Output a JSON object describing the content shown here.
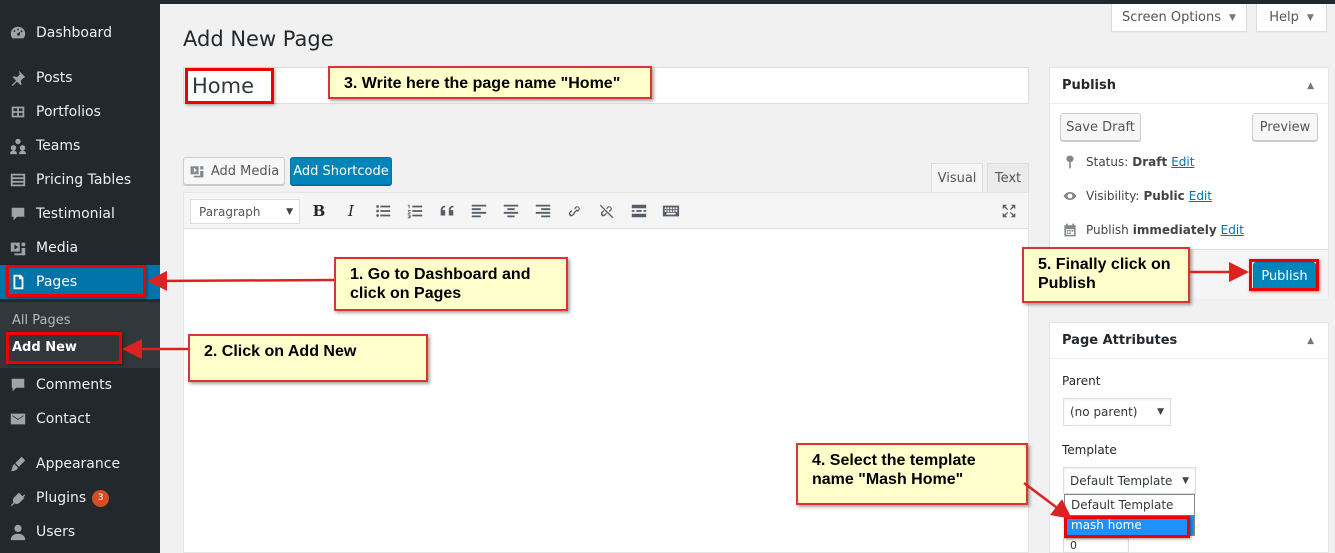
{
  "colors": {
    "sidebar_bg": "#23282d",
    "accent_blue": "#0073aa",
    "primary_button": "#0085ba",
    "annotation_fill": "#ffffcc",
    "annotation_border": "#dd3333",
    "badge": "#d54e21"
  },
  "sidebar": {
    "items": [
      {
        "label": "Dashboard",
        "icon": "dashboard-icon"
      },
      {
        "label": "Posts",
        "icon": "pin-icon"
      },
      {
        "label": "Portfolios",
        "icon": "portfolio-icon"
      },
      {
        "label": "Teams",
        "icon": "groups-icon"
      },
      {
        "label": "Pricing Tables",
        "icon": "list-icon"
      },
      {
        "label": "Testimonial",
        "icon": "speech-bubble-icon"
      },
      {
        "label": "Media",
        "icon": "media-icon"
      },
      {
        "label": "Pages",
        "icon": "page-icon"
      },
      {
        "label": "Comments",
        "icon": "comment-icon"
      },
      {
        "label": "Contact",
        "icon": "mail-icon"
      },
      {
        "label": "Appearance",
        "icon": "brush-icon"
      },
      {
        "label": "Plugins",
        "icon": "plug-icon",
        "badge": "3"
      },
      {
        "label": "Users",
        "icon": "user-icon"
      }
    ],
    "submenu": [
      {
        "label": "All Pages"
      },
      {
        "label": "Add New"
      }
    ]
  },
  "header": {
    "title": "Add New Page",
    "screen_options": "Screen Options",
    "help": "Help"
  },
  "editor": {
    "title_value": "Home",
    "add_media": "Add Media",
    "add_shortcode": "Add Shortcode",
    "tab_visual": "Visual",
    "tab_text": "Text",
    "format": "Paragraph",
    "toolbar_icons": [
      "bold-icon",
      "italic-icon",
      "bullet-list-icon",
      "numbered-list-icon",
      "blockquote-icon",
      "align-left-icon",
      "align-center-icon",
      "align-right-icon",
      "link-icon",
      "unlink-icon",
      "read-more-icon",
      "toolbar-toggle-icon",
      "fullscreen-icon"
    ]
  },
  "publish": {
    "heading": "Publish",
    "save_draft": "Save Draft",
    "preview": "Preview",
    "status_label": "Status:",
    "status_value": "Draft",
    "visibility_label": "Visibility:",
    "visibility_value": "Public",
    "schedule_label": "Publish",
    "schedule_value": "immediately",
    "edit": "Edit",
    "publish_button": "Publish"
  },
  "page_attributes": {
    "heading": "Page Attributes",
    "parent_label": "Parent",
    "parent_value": "(no parent)",
    "template_label": "Template",
    "template_value": "Default Template",
    "template_options": [
      "Default Template",
      "mash home"
    ],
    "order_value": "0"
  },
  "annotations": {
    "step1": "1. Go to Dashboard and click on Pages",
    "step2": "2. Click on Add New",
    "step3": "3. Write here the page name \"Home\"",
    "step4": "4. Select the template name \"Mash Home\"",
    "step5": "5. Finally click on Publish"
  }
}
